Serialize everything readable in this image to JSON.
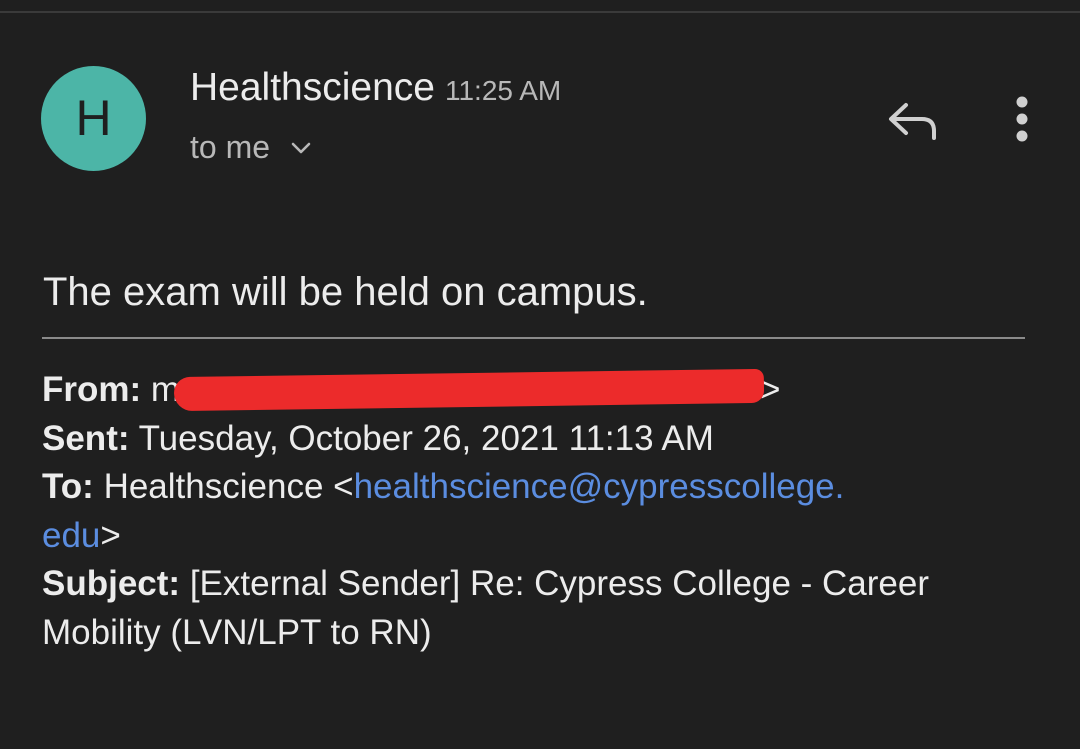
{
  "header": {
    "avatar_letter": "H",
    "sender_name": "Healthscience",
    "time": "11:25 AM",
    "recipient": "to me"
  },
  "icons": {
    "reply": "reply-icon",
    "more": "more-vert-icon",
    "expand": "chevron-down-icon"
  },
  "colors": {
    "background": "#1f1f1f",
    "avatar": "#4cb5a7",
    "link": "#5b8de0",
    "redaction": "#ec2b2b"
  },
  "message": {
    "body": "The exam will be held on campus."
  },
  "quoted": {
    "from_label": "From:",
    "from_visible_start": "m",
    "from_visible_end": ">",
    "sent_label": "Sent:",
    "sent_value": "Tuesday, October 26, 2021 11:13 AM",
    "to_label": "To:",
    "to_name": "Healthscience <",
    "to_email_part1": "healthscience@cypresscollege.",
    "to_email_part2": "edu",
    "to_close": ">",
    "subject_label": "Subject:",
    "subject_line1": "[External Sender] Re: Cypress College - Career",
    "subject_line2": "Mobility (LVN/LPT to RN)"
  }
}
